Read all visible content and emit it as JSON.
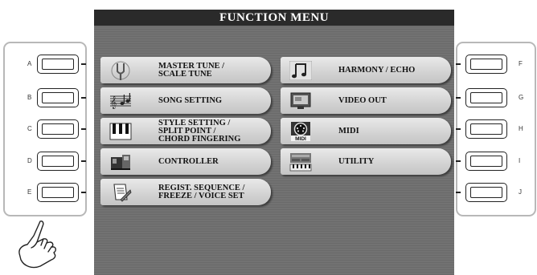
{
  "screen": {
    "title": "FUNCTION MENU"
  },
  "left_buttons": [
    "A",
    "B",
    "C",
    "D",
    "E"
  ],
  "right_buttons": [
    "F",
    "G",
    "H",
    "I",
    "J"
  ],
  "menu": {
    "left": [
      {
        "label": "MASTER TUNE /\nSCALE TUNE",
        "icon": "tuning-fork-icon"
      },
      {
        "label": "SONG SETTING",
        "icon": "music-score-icon"
      },
      {
        "label": "STYLE SETTING /\nSPLIT POINT /\nCHORD FINGERING",
        "icon": "keyboard-keys-icon"
      },
      {
        "label": "CONTROLLER",
        "icon": "controller-icon"
      },
      {
        "label": "REGIST. SEQUENCE /\nFREEZE / VOICE SET",
        "icon": "registration-icon"
      }
    ],
    "right": [
      {
        "label": "HARMONY / ECHO",
        "icon": "music-note-icon"
      },
      {
        "label": "VIDEO OUT",
        "icon": "video-monitor-icon"
      },
      {
        "label": "MIDI",
        "icon": "midi-connector-icon",
        "icon_text": "MIDI"
      },
      {
        "label": "UTILITY",
        "icon": "utility-icon"
      }
    ]
  }
}
